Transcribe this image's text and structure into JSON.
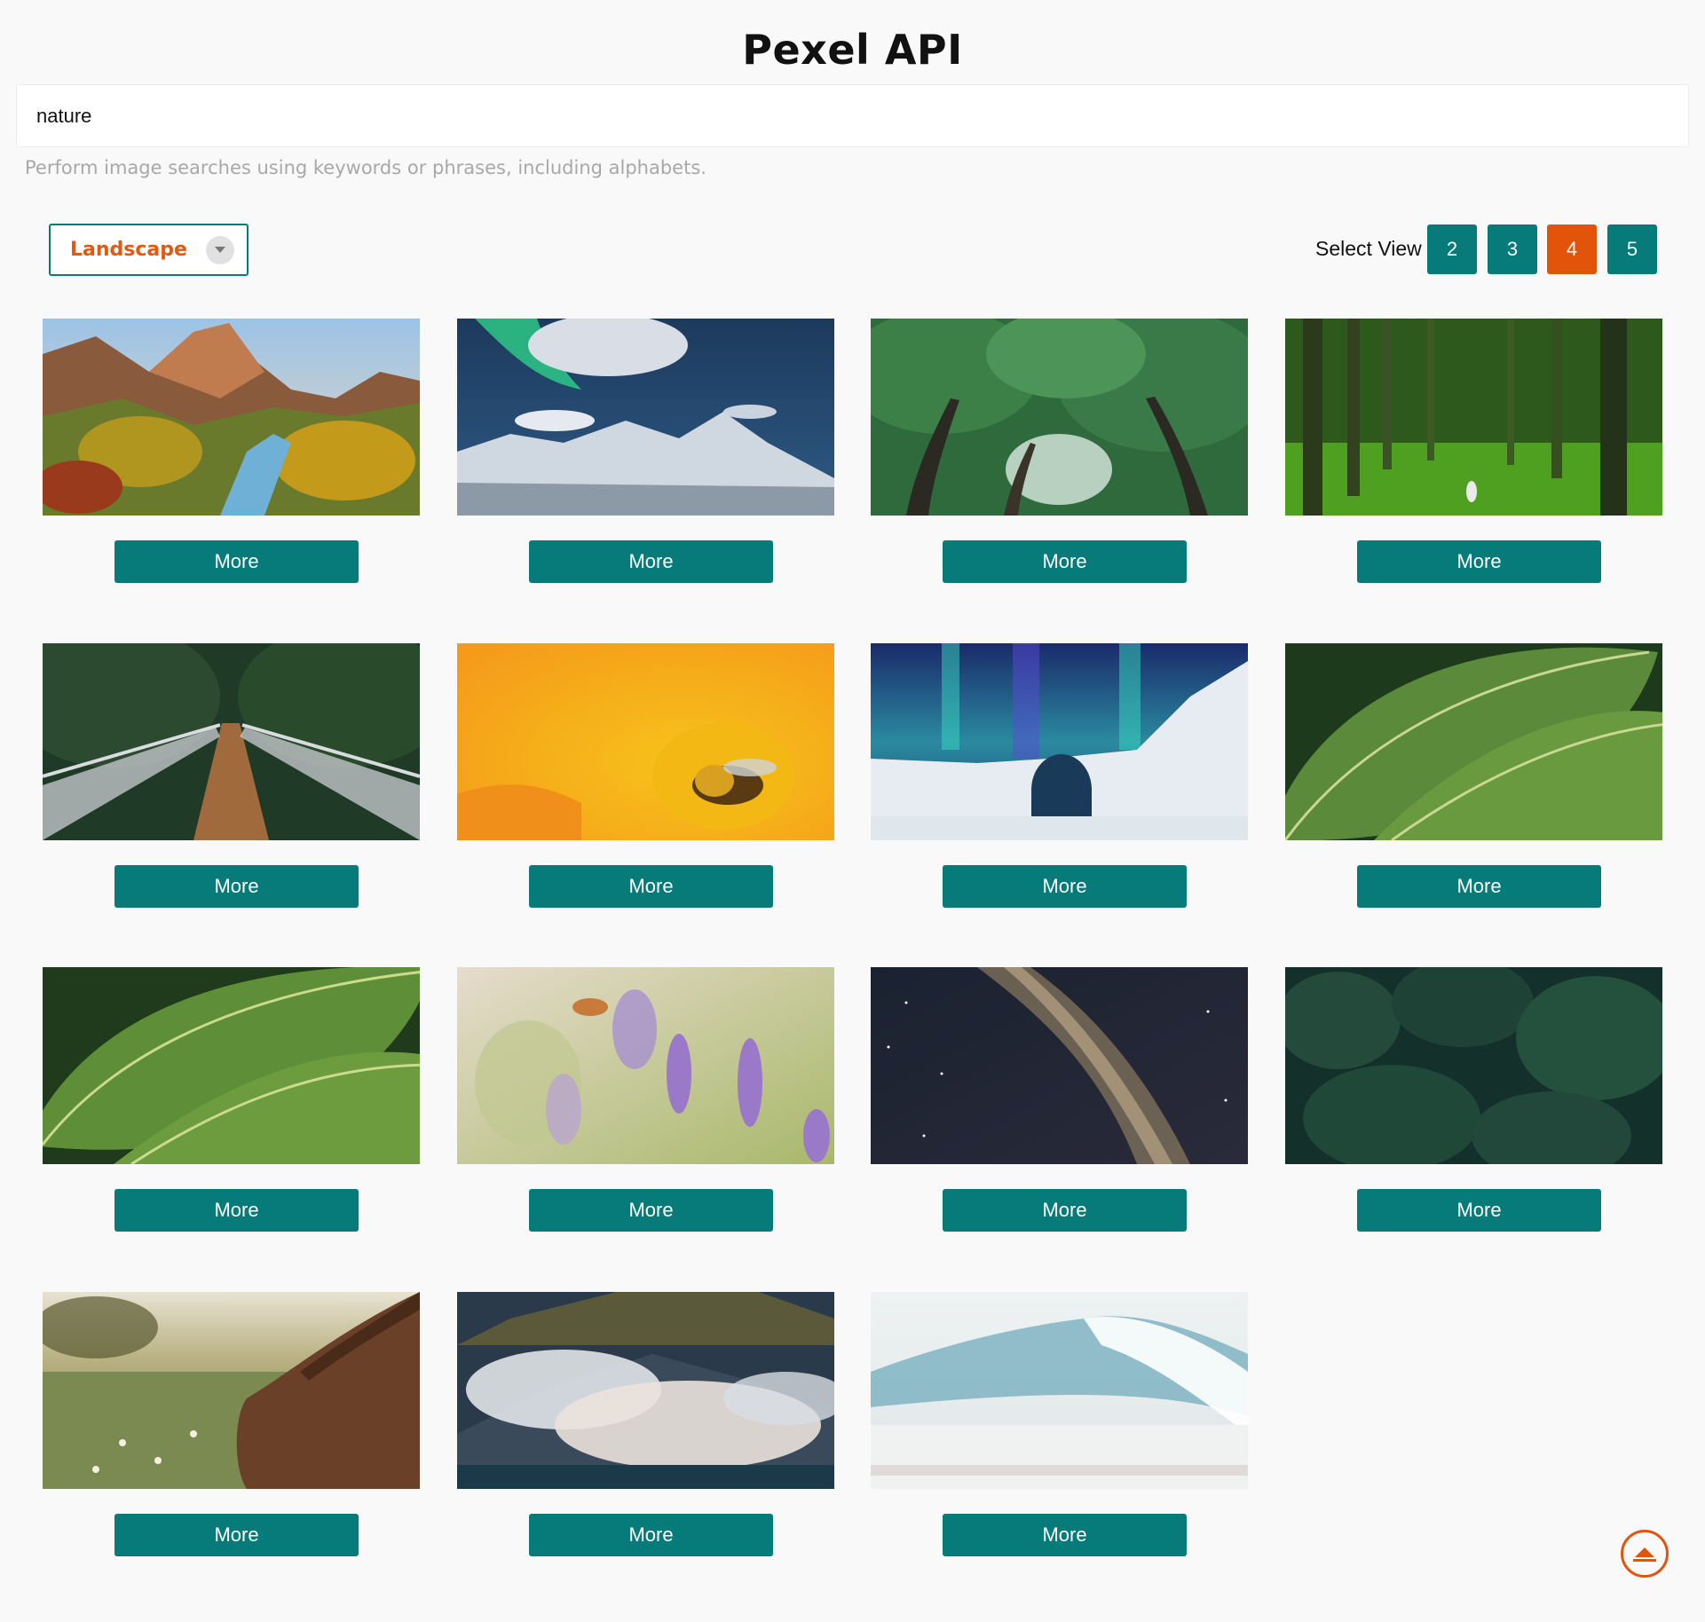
{
  "header": {
    "title": "Pexel API"
  },
  "search": {
    "value": "nature",
    "hint": "Perform image searches using keywords or phrases, including alphabets."
  },
  "orientation": {
    "selected": "Landscape"
  },
  "view_selector": {
    "label": "Select View",
    "options": [
      "2",
      "3",
      "4",
      "5"
    ],
    "active": "4"
  },
  "cards": [
    {
      "subject": "canyon-valley-river",
      "button": "More"
    },
    {
      "subject": "aurora-snowy-mountains",
      "button": "More"
    },
    {
      "subject": "green-tree-canopy",
      "button": "More"
    },
    {
      "subject": "pine-forest-hiker",
      "button": "More"
    },
    {
      "subject": "suspension-bridge-forest",
      "button": "More"
    },
    {
      "subject": "bee-on-yellow-flower",
      "button": "More"
    },
    {
      "subject": "aurora-ice-hotel",
      "button": "More"
    },
    {
      "subject": "tropical-leaves",
      "button": "More"
    },
    {
      "subject": "tropical-leaves-closeup",
      "button": "More"
    },
    {
      "subject": "moth-lavender",
      "button": "More"
    },
    {
      "subject": "milky-way-sky",
      "button": "More"
    },
    {
      "subject": "evergreen-trees-aerial",
      "button": "More"
    },
    {
      "subject": "horse-grazing-flowers",
      "button": "More"
    },
    {
      "subject": "clouds-over-mountain",
      "button": "More"
    },
    {
      "subject": "ocean-wave",
      "button": "More"
    }
  ],
  "colors": {
    "teal": "#077a7a",
    "orange": "#e3540b",
    "background": "#f9f9f9"
  },
  "icons": {
    "orientation_caret": "chevron-down-icon",
    "scroll_top": "arrow-up-circle-icon"
  }
}
